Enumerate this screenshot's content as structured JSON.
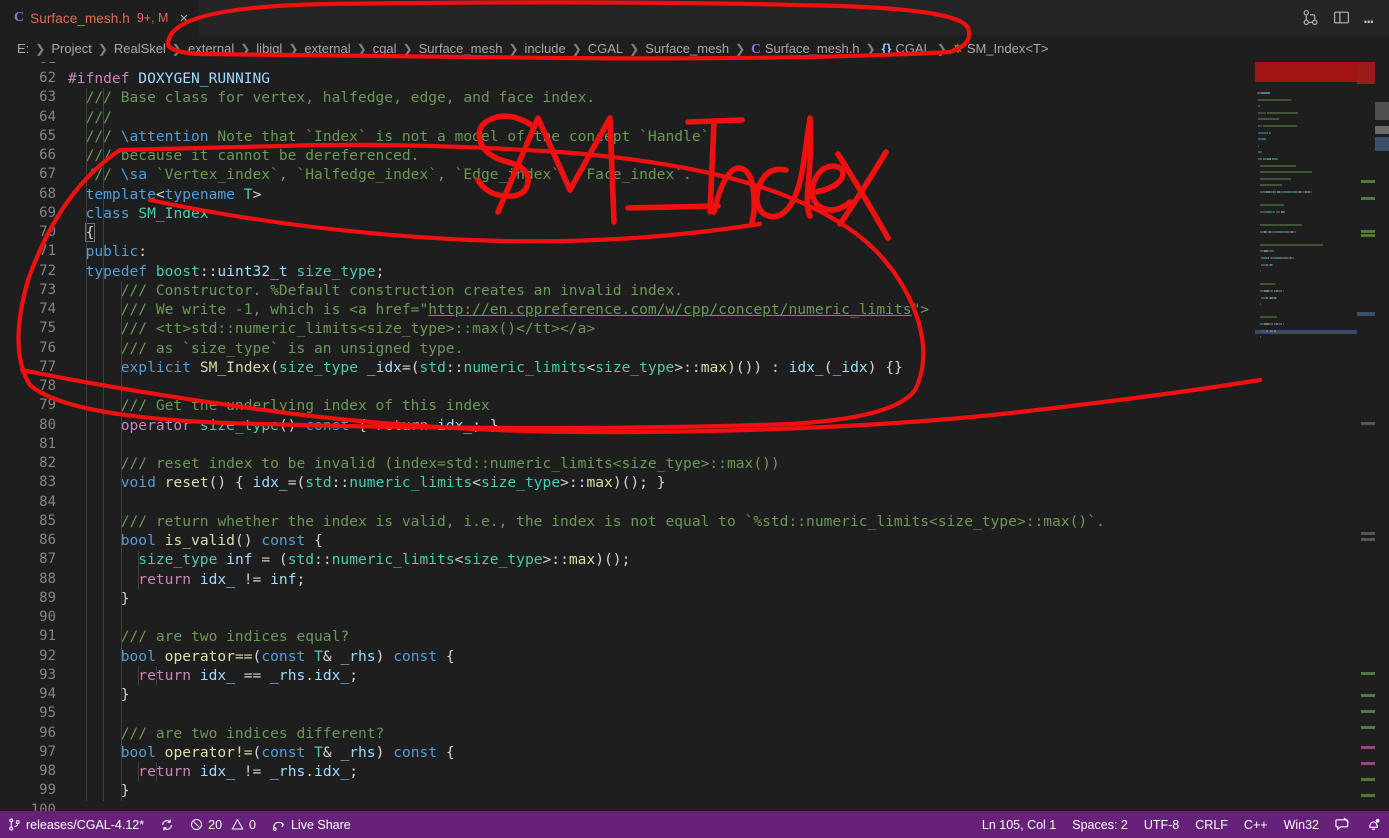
{
  "window": {
    "title_actions": [
      {
        "name": "split-editor-icon",
        "label": "Split Editor"
      },
      {
        "name": "toggle-panel-icon",
        "label": "Toggle Panel Layout"
      },
      {
        "name": "more-actions-icon",
        "label": "…"
      }
    ]
  },
  "tab": {
    "lang_icon": "C",
    "filename": "Surface_mesh.h",
    "badge": "9+, M",
    "close": "×"
  },
  "breadcrumb": {
    "items": [
      {
        "label": "E:",
        "icon": ""
      },
      {
        "label": "Project",
        "icon": ""
      },
      {
        "label": "RealSkel",
        "icon": ""
      },
      {
        "label": "external",
        "icon": ""
      },
      {
        "label": "libigl",
        "icon": ""
      },
      {
        "label": "external",
        "icon": ""
      },
      {
        "label": "cgal",
        "icon": ""
      },
      {
        "label": "Surface_mesh",
        "icon": ""
      },
      {
        "label": "include",
        "icon": ""
      },
      {
        "label": "CGAL",
        "icon": ""
      },
      {
        "label": "Surface_mesh",
        "icon": ""
      },
      {
        "label": "Surface_mesh.h",
        "icon": "C"
      },
      {
        "label": "CGAL",
        "icon": "{}"
      },
      {
        "label": "SM_Index<T>",
        "icon": "class"
      }
    ],
    "separator": "❯"
  },
  "code": {
    "first_line": 61,
    "partial_top_line": "61",
    "lines": [
      {
        "n": 62,
        "indent": 0,
        "tokens": [
          {
            "t": "#ifndef ",
            "c": "kp"
          },
          {
            "t": "DOXYGEN_RUNNING",
            "c": "v"
          }
        ]
      },
      {
        "n": 63,
        "indent": 1,
        "tokens": [
          {
            "t": "  /// Base class for vertex, halfedge, edge, and face index.",
            "c": "c"
          }
        ]
      },
      {
        "n": 64,
        "indent": 1,
        "tokens": [
          {
            "t": "  ///",
            "c": "c"
          }
        ]
      },
      {
        "n": 65,
        "indent": 1,
        "tokens": [
          {
            "t": "  /// ",
            "c": "c"
          },
          {
            "t": "\\attention",
            "c": "cd"
          },
          {
            "t": " Note that `Index` is not a model of the concept `Handle`,",
            "c": "c"
          }
        ]
      },
      {
        "n": 66,
        "indent": 1,
        "tokens": [
          {
            "t": "  /// because it cannot be dereferenced.",
            "c": "c"
          }
        ]
      },
      {
        "n": 67,
        "indent": 1,
        "tokens": [
          {
            "t": "  /// ",
            "c": "c"
          },
          {
            "t": "\\sa",
            "c": "cd"
          },
          {
            "t": " `Vertex_index`, `Halfedge_index`, `Edge_index`, `Face_index`.",
            "c": "c"
          }
        ]
      },
      {
        "n": 68,
        "indent": 1,
        "tokens": [
          {
            "t": "  ",
            "c": "p"
          },
          {
            "t": "template",
            "c": "k"
          },
          {
            "t": "<",
            "c": "p"
          },
          {
            "t": "typename",
            "c": "k"
          },
          {
            "t": " ",
            "c": "p"
          },
          {
            "t": "T",
            "c": "t"
          },
          {
            "t": ">",
            "c": "p"
          }
        ]
      },
      {
        "n": 69,
        "indent": 1,
        "tokens": [
          {
            "t": "  ",
            "c": "p"
          },
          {
            "t": "class",
            "c": "k"
          },
          {
            "t": " ",
            "c": "p"
          },
          {
            "t": "SM_Index",
            "c": "t"
          }
        ]
      },
      {
        "n": 70,
        "indent": 1,
        "tokens": [
          {
            "t": "  ",
            "c": "p"
          },
          {
            "t": "{",
            "c": "brktp"
          }
        ]
      },
      {
        "n": 71,
        "indent": 1,
        "tokens": [
          {
            "t": "  ",
            "c": "p"
          },
          {
            "t": "public",
            "c": "k"
          },
          {
            "t": ":",
            "c": "p"
          }
        ]
      },
      {
        "n": 72,
        "indent": 1,
        "tokens": [
          {
            "t": "  ",
            "c": "p"
          },
          {
            "t": "typedef",
            "c": "k"
          },
          {
            "t": " ",
            "c": "p"
          },
          {
            "t": "boost",
            "c": "t"
          },
          {
            "t": "::",
            "c": "p"
          },
          {
            "t": "uint32_t",
            "c": "v"
          },
          {
            "t": " ",
            "c": "p"
          },
          {
            "t": "size_type",
            "c": "t"
          },
          {
            "t": ";",
            "c": "p"
          }
        ]
      },
      {
        "n": 73,
        "indent": 2,
        "tokens": [
          {
            "t": "      /// Constructor. %Default construction creates an invalid index.",
            "c": "c"
          }
        ]
      },
      {
        "n": 74,
        "indent": 2,
        "tokens": [
          {
            "t": "      /// We write -1, which is <a href=\"",
            "c": "c"
          },
          {
            "t": "http://en.cppreference.com/w/cpp/concept/numeric_limits",
            "c": "lnk"
          },
          {
            "t": "\">",
            "c": "c"
          }
        ]
      },
      {
        "n": 75,
        "indent": 2,
        "tokens": [
          {
            "t": "      /// <tt>std::numeric_limits<size_type>::max()</tt></a>",
            "c": "c"
          }
        ]
      },
      {
        "n": 76,
        "indent": 2,
        "tokens": [
          {
            "t": "      /// as `size_type` is an unsigned type.",
            "c": "c"
          }
        ]
      },
      {
        "n": 77,
        "indent": 2,
        "tokens": [
          {
            "t": "      ",
            "c": "p"
          },
          {
            "t": "explicit",
            "c": "k"
          },
          {
            "t": " ",
            "c": "p"
          },
          {
            "t": "SM_Index",
            "c": "f"
          },
          {
            "t": "(",
            "c": "p"
          },
          {
            "t": "size_type",
            "c": "t"
          },
          {
            "t": " ",
            "c": "p"
          },
          {
            "t": "_idx",
            "c": "v"
          },
          {
            "t": "=(",
            "c": "p"
          },
          {
            "t": "std",
            "c": "t"
          },
          {
            "t": "::",
            "c": "p"
          },
          {
            "t": "numeric_limits",
            "c": "t"
          },
          {
            "t": "<",
            "c": "p"
          },
          {
            "t": "size_type",
            "c": "t"
          },
          {
            "t": ">::",
            "c": "p"
          },
          {
            "t": "max",
            "c": "f"
          },
          {
            "t": ")()) : ",
            "c": "p"
          },
          {
            "t": "idx_",
            "c": "v"
          },
          {
            "t": "(",
            "c": "p"
          },
          {
            "t": "_idx",
            "c": "v"
          },
          {
            "t": ") {}",
            "c": "p"
          }
        ]
      },
      {
        "n": 78,
        "indent": 2,
        "tokens": []
      },
      {
        "n": 79,
        "indent": 2,
        "tokens": [
          {
            "t": "      /// Get the underlying index of this index",
            "c": "c"
          }
        ]
      },
      {
        "n": 80,
        "indent": 2,
        "tokens": [
          {
            "t": "      ",
            "c": "p"
          },
          {
            "t": "operator",
            "c": "kp"
          },
          {
            "t": " ",
            "c": "p"
          },
          {
            "t": "size_type",
            "c": "t"
          },
          {
            "t": "() ",
            "c": "p"
          },
          {
            "t": "const",
            "c": "k"
          },
          {
            "t": " { ",
            "c": "p"
          },
          {
            "t": "return",
            "c": "kp"
          },
          {
            "t": " ",
            "c": "p"
          },
          {
            "t": "idx_",
            "c": "v"
          },
          {
            "t": "; }",
            "c": "p"
          }
        ]
      },
      {
        "n": 81,
        "indent": 2,
        "tokens": []
      },
      {
        "n": 82,
        "indent": 2,
        "tokens": [
          {
            "t": "      /// reset index to be invalid (index=std::numeric_limits<size_type>::max())",
            "c": "c"
          }
        ]
      },
      {
        "n": 83,
        "indent": 2,
        "tokens": [
          {
            "t": "      ",
            "c": "p"
          },
          {
            "t": "void",
            "c": "k"
          },
          {
            "t": " ",
            "c": "p"
          },
          {
            "t": "reset",
            "c": "f"
          },
          {
            "t": "() { ",
            "c": "p"
          },
          {
            "t": "idx_",
            "c": "v"
          },
          {
            "t": "=(",
            "c": "p"
          },
          {
            "t": "std",
            "c": "t"
          },
          {
            "t": "::",
            "c": "p"
          },
          {
            "t": "numeric_limits",
            "c": "t"
          },
          {
            "t": "<",
            "c": "p"
          },
          {
            "t": "size_type",
            "c": "t"
          },
          {
            "t": ">::",
            "c": "p"
          },
          {
            "t": "max",
            "c": "f"
          },
          {
            "t": ")(); }",
            "c": "p"
          }
        ]
      },
      {
        "n": 84,
        "indent": 2,
        "tokens": []
      },
      {
        "n": 85,
        "indent": 2,
        "tokens": [
          {
            "t": "      /// return whether the index is valid, i.e., the index is not equal to `%std::numeric_limits<size_type>::max()`.",
            "c": "c"
          }
        ]
      },
      {
        "n": 86,
        "indent": 2,
        "tokens": [
          {
            "t": "      ",
            "c": "p"
          },
          {
            "t": "bool",
            "c": "k"
          },
          {
            "t": " ",
            "c": "p"
          },
          {
            "t": "is_valid",
            "c": "f"
          },
          {
            "t": "() ",
            "c": "p"
          },
          {
            "t": "const",
            "c": "k"
          },
          {
            "t": " {",
            "c": "p"
          }
        ]
      },
      {
        "n": 87,
        "indent": 3,
        "tokens": [
          {
            "t": "        ",
            "c": "p"
          },
          {
            "t": "size_type",
            "c": "t"
          },
          {
            "t": " ",
            "c": "p"
          },
          {
            "t": "inf",
            "c": "v"
          },
          {
            "t": " = (",
            "c": "p"
          },
          {
            "t": "std",
            "c": "t"
          },
          {
            "t": "::",
            "c": "p"
          },
          {
            "t": "numeric_limits",
            "c": "t"
          },
          {
            "t": "<",
            "c": "p"
          },
          {
            "t": "size_type",
            "c": "t"
          },
          {
            "t": ">::",
            "c": "p"
          },
          {
            "t": "max",
            "c": "f"
          },
          {
            "t": ")();",
            "c": "p"
          }
        ]
      },
      {
        "n": 88,
        "indent": 3,
        "tokens": [
          {
            "t": "        ",
            "c": "p"
          },
          {
            "t": "return",
            "c": "kp"
          },
          {
            "t": " ",
            "c": "p"
          },
          {
            "t": "idx_",
            "c": "v"
          },
          {
            "t": " != ",
            "c": "p"
          },
          {
            "t": "inf",
            "c": "v"
          },
          {
            "t": ";",
            "c": "p"
          }
        ]
      },
      {
        "n": 89,
        "indent": 2,
        "tokens": [
          {
            "t": "      }",
            "c": "p"
          }
        ]
      },
      {
        "n": 90,
        "indent": 2,
        "tokens": []
      },
      {
        "n": 91,
        "indent": 2,
        "tokens": [
          {
            "t": "      /// are two indices equal?",
            "c": "c"
          }
        ]
      },
      {
        "n": 92,
        "indent": 2,
        "tokens": [
          {
            "t": "      ",
            "c": "p"
          },
          {
            "t": "bool",
            "c": "k"
          },
          {
            "t": " ",
            "c": "p"
          },
          {
            "t": "operator==",
            "c": "f"
          },
          {
            "t": "(",
            "c": "p"
          },
          {
            "t": "const",
            "c": "k"
          },
          {
            "t": " ",
            "c": "p"
          },
          {
            "t": "T",
            "c": "t"
          },
          {
            "t": "& ",
            "c": "p"
          },
          {
            "t": "_rhs",
            "c": "v"
          },
          {
            "t": ") ",
            "c": "p"
          },
          {
            "t": "const",
            "c": "k"
          },
          {
            "t": " {",
            "c": "p"
          }
        ]
      },
      {
        "n": 93,
        "indent": 3,
        "tokens": [
          {
            "t": "        ",
            "c": "p"
          },
          {
            "t": "return",
            "c": "kp"
          },
          {
            "t": " ",
            "c": "p"
          },
          {
            "t": "idx_",
            "c": "v"
          },
          {
            "t": " == ",
            "c": "p"
          },
          {
            "t": "_rhs",
            "c": "v"
          },
          {
            "t": ".",
            "c": "p"
          },
          {
            "t": "idx_",
            "c": "v"
          },
          {
            "t": ";",
            "c": "p"
          }
        ]
      },
      {
        "n": 94,
        "indent": 2,
        "tokens": [
          {
            "t": "      }",
            "c": "p"
          }
        ]
      },
      {
        "n": 95,
        "indent": 2,
        "tokens": []
      },
      {
        "n": 96,
        "indent": 2,
        "tokens": [
          {
            "t": "      /// are two indices different?",
            "c": "c"
          }
        ]
      },
      {
        "n": 97,
        "indent": 2,
        "tokens": [
          {
            "t": "      ",
            "c": "p"
          },
          {
            "t": "bool",
            "c": "k"
          },
          {
            "t": " ",
            "c": "p"
          },
          {
            "t": "operator!=",
            "c": "f"
          },
          {
            "t": "(",
            "c": "p"
          },
          {
            "t": "const",
            "c": "k"
          },
          {
            "t": " ",
            "c": "p"
          },
          {
            "t": "T",
            "c": "t"
          },
          {
            "t": "& ",
            "c": "p"
          },
          {
            "t": "_rhs",
            "c": "v"
          },
          {
            "t": ") ",
            "c": "p"
          },
          {
            "t": "const",
            "c": "k"
          },
          {
            "t": " {",
            "c": "p"
          }
        ]
      },
      {
        "n": 98,
        "indent": 3,
        "tokens": [
          {
            "t": "        ",
            "c": "p"
          },
          {
            "t": "return",
            "c": "kp"
          },
          {
            "t": " ",
            "c": "p"
          },
          {
            "t": "idx_",
            "c": "v"
          },
          {
            "t": " != ",
            "c": "p"
          },
          {
            "t": "_rhs",
            "c": "v"
          },
          {
            "t": ".",
            "c": "p"
          },
          {
            "t": "idx_",
            "c": "v"
          },
          {
            "t": ";",
            "c": "p"
          }
        ]
      },
      {
        "n": 99,
        "indent": 2,
        "tokens": [
          {
            "t": "      }",
            "c": "p"
          }
        ]
      },
      {
        "n": 100,
        "indent": 2,
        "tokens": []
      }
    ]
  },
  "statusbar": {
    "branch": "releases/CGAL-4.12*",
    "sync_icon": "sync-icon",
    "errors": "20",
    "warnings": "0",
    "live_share": "Live Share",
    "cursor": "Ln 105, Col 1",
    "spaces": "Spaces: 2",
    "encoding": "UTF-8",
    "eol": "CRLF",
    "language": "C++",
    "platform": "Win32",
    "feedback_icon": "feedback-icon",
    "bell_icon": "bell-dot-icon"
  },
  "annotation": {
    "text": "SM_Index",
    "color": "#f01010",
    "description": "handwritten red ink annotation circling the SM_Index class declaration"
  },
  "colors": {
    "editor_bg": "#1e1e1e",
    "tabbar_bg": "#252526",
    "statusbar_bg": "#68217a",
    "comment": "#6a9955",
    "keyword": "#569cd6",
    "control": "#c586c0",
    "type": "#4ec9b0",
    "variable": "#9cdcfe",
    "function": "#dcdcaa",
    "linenum": "#858585",
    "annotation_red": "#f01010"
  }
}
